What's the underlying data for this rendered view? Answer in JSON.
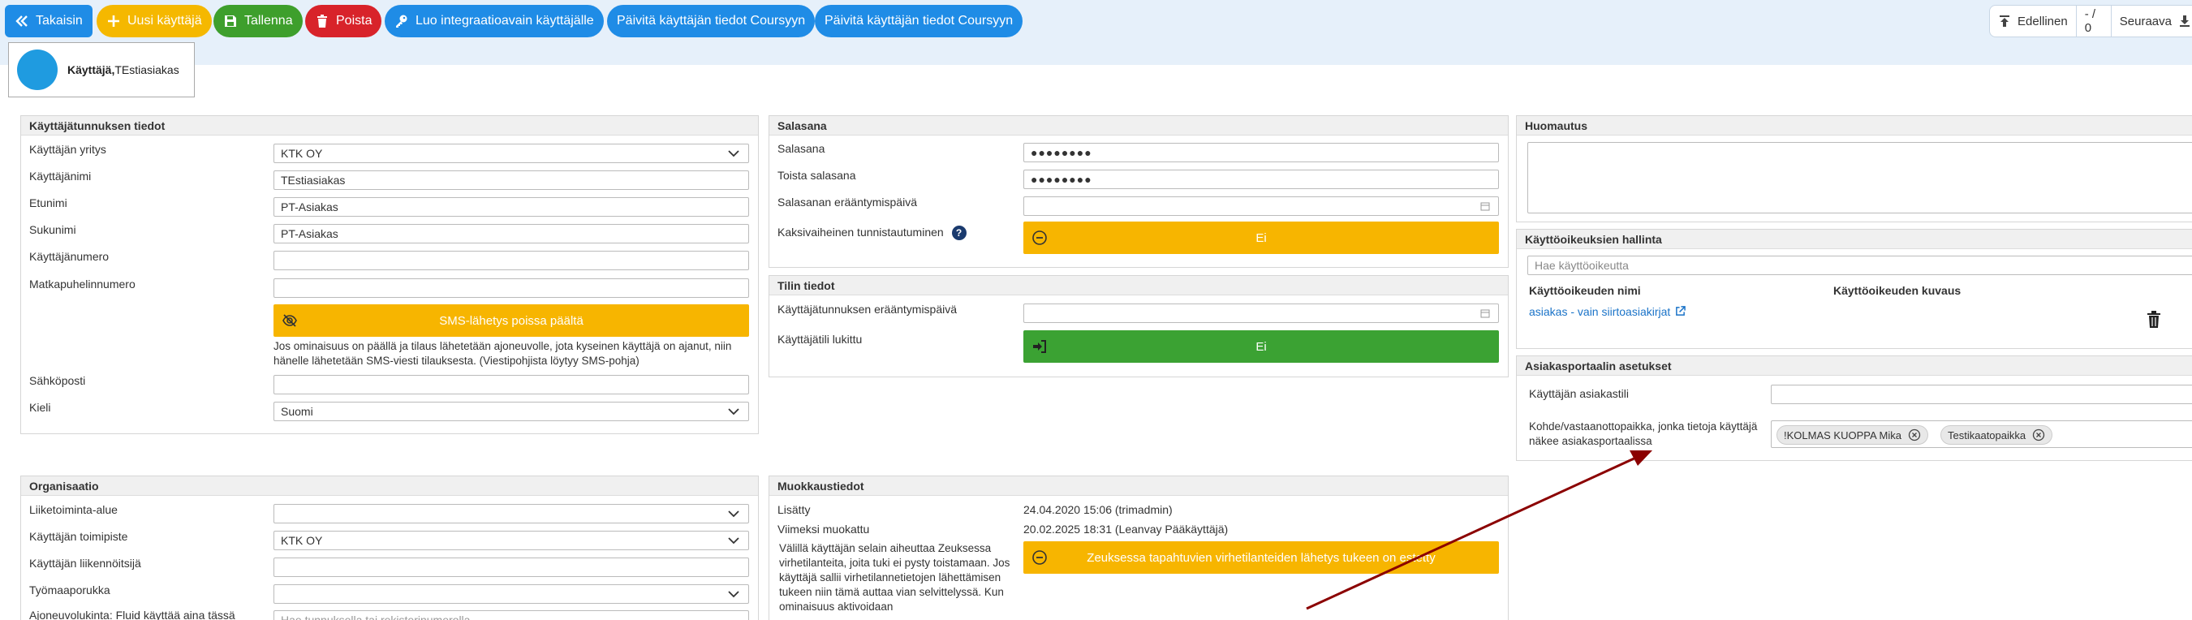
{
  "toolbar": {
    "back": "Takaisin",
    "new_user": "Uusi käyttäjä",
    "save": "Tallenna",
    "delete": "Poista",
    "create_key": "Luo integraatioavain käyttäjälle",
    "update1": "Päivitä käyttäjän tiedot Coursyyn",
    "update2": "Päivitä käyttäjän tiedot Coursyyn",
    "prev": "Edellinen",
    "counter": "- / 0",
    "next": "Seuraava"
  },
  "user": {
    "prefix": "Käyttäjä,",
    "name": "TEstiasiakas"
  },
  "account_info": {
    "title": "Käyttäjätunnuksen tiedot",
    "company_label": "Käyttäjän yritys",
    "company_value": "KTK OY",
    "username_label": "Käyttäjänimi",
    "username_value": "TEstiasiakas",
    "firstname_label": "Etunimi",
    "firstname_value": "PT-Asiakas",
    "lastname_label": "Sukunimi",
    "lastname_value": "PT-Asiakas",
    "usernum_label": "Käyttäjänumero",
    "usernum_value": "",
    "phone_label": "Matkapuhelinnumero",
    "phone_value": "",
    "sms_bar": "SMS-lähetys poissa päältä",
    "sms_help": "Jos ominaisuus on päällä ja tilaus lähetetään ajoneuvolle, jota kyseinen käyttäjä on ajanut, niin hänelle lähetetään SMS-viesti tilauksesta. (Viestipohjista löytyy SMS-pohja)",
    "email_label": "Sähköposti",
    "email_value": "",
    "lang_label": "Kieli",
    "lang_value": "Suomi"
  },
  "password": {
    "title": "Salasana",
    "pw_label": "Salasana",
    "pw_value": "●●●●●●●●",
    "pw2_label": "Toista salasana",
    "pw2_value": "●●●●●●●●",
    "expiry_label": "Salasanan erääntymispäivä",
    "twofa_label": "Kaksivaiheinen tunnistautuminen",
    "help_icon_text": "?",
    "twofa_bar": "Ei"
  },
  "account": {
    "title": "Tilin tiedot",
    "expiry_label": "Käyttäjätunnuksen erääntymispäivä",
    "locked_label": "Käyttäjätili lukittu",
    "locked_bar": "Ei"
  },
  "note": {
    "title": "Huomautus",
    "value": ""
  },
  "rights": {
    "title": "Käyttöoikeuksien hallinta",
    "search_placeholder": "Hae käyttöoikeutta",
    "col_name": "Käyttöoikeuden nimi",
    "col_desc": "Käyttöoikeuden kuvaus",
    "rows": [
      {
        "name": "asiakas - vain siirtoasiakirjat",
        "desc": ""
      }
    ]
  },
  "portal": {
    "title": "Asiakasportaalin asetukset",
    "id_label": "Käyttäjän asiakastili",
    "places_label": "Kohde/vastaanottopaikka, jonka tietoja käyttäjä näkee asiakasportaalissa",
    "chips": [
      "!KOLMAS KUOPPA Mika",
      "Testikaatopaikka"
    ]
  },
  "org": {
    "title": "Organisaatio",
    "area_label": "Liiketoiminta-alue",
    "area_value": "",
    "office_label": "Käyttäjän toimipiste",
    "office_value": "KTK OY",
    "operator_label": "Käyttäjän liikennöitsijä",
    "operator_value": "",
    "group_label": "Työmaaporukka",
    "group_value": "",
    "vehicle_label": "Ajoneuvolukinta: Fluid käyttää aina tässä",
    "vehicle_placeholder": "Hae tunnuksella tai rekisterinumerolla"
  },
  "edit": {
    "title": "Muokkaustiedot",
    "added_label": "Lisätty",
    "added_value": "24.04.2020 15:06 (trimadmin)",
    "modified_label": "Viimeksi muokattu",
    "modified_value": "20.02.2025 18:31 (Leanvay Pääkäyttäjä)",
    "errors_text": "Välillä käyttäjän selain aiheuttaa Zeuksessa virhetilanteita, joita tuki ei pysty toistamaan. Jos käyttäjä sallii virhetilannetietojen lähettämisen tukeen niin tämä auttaa vian selvittelyssä. Kun ominaisuus aktivoidaan",
    "errors_bar": "Zeuksessa tapahtuvien virhetilanteiden lähetys tukeen on estetty"
  }
}
